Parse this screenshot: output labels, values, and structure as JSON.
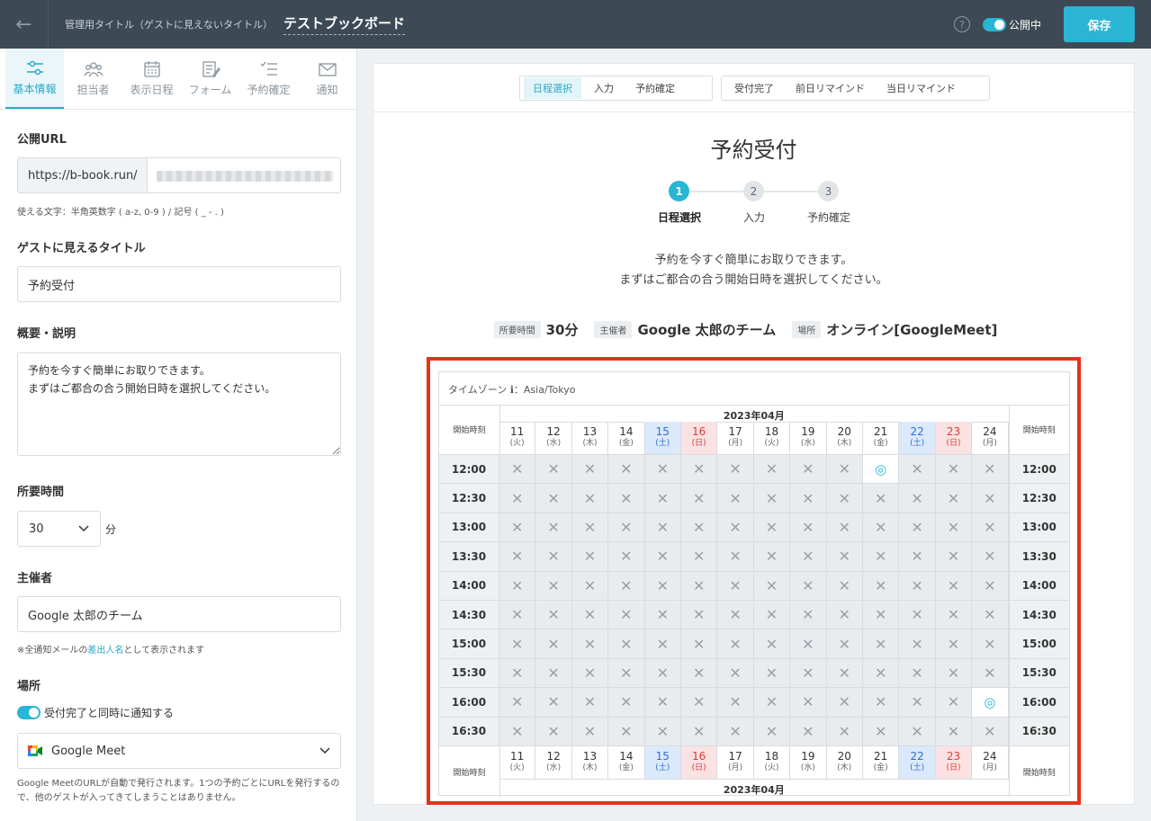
{
  "header": {
    "admin_title_label": "管理用タイトル（ゲストに見えないタイトル）",
    "board_title": "テストブックボード",
    "publish_label": "公開中",
    "save_label": "保存"
  },
  "sidebar_tabs": [
    {
      "label": "基本情報",
      "icon": "sliders-icon"
    },
    {
      "label": "担当者",
      "icon": "people-icon"
    },
    {
      "label": "表示日程",
      "icon": "calendar-icon"
    },
    {
      "label": "フォーム",
      "icon": "form-icon"
    },
    {
      "label": "予約確定",
      "icon": "list-check-icon"
    },
    {
      "label": "通知",
      "icon": "mail-icon"
    }
  ],
  "form": {
    "url_label": "公開URL",
    "url_prefix": "https://b-book.run/",
    "url_hint": "使える文字：半角英数字 ( a-z, 0-9 ) / 記号 ( _ - . )",
    "guest_title_label": "ゲストに見えるタイトル",
    "guest_title_value": "予約受付",
    "desc_label": "概要・説明",
    "desc_value": "予約を今すぐ簡単にお取りできます。\nまずはご都合の合う開始日時を選択してください。",
    "duration_label": "所要時間",
    "duration_value": "30",
    "duration_unit": "分",
    "organizer_label": "主催者",
    "organizer_value": "Google 太郎のチーム",
    "organizer_hint_pre": "※全通知メールの",
    "organizer_hint_link": "差出人名",
    "organizer_hint_post": "として表示されます",
    "place_label": "場所",
    "notify_label": "受付完了と同時に通知する",
    "place_value": "Google Meet",
    "meet_hint": "Google MeetのURLが自動で発行されます。1つの予約ごとにURLを発行するので、他のゲストが入ってきてしまうことはありません。"
  },
  "preview": {
    "tabs_group1": [
      "日程選択",
      "入力",
      "予約確定"
    ],
    "tabs_group2": [
      "受付完了",
      "前日リマインド",
      "当日リマインド"
    ],
    "title": "予約受付",
    "steps": [
      {
        "num": "1",
        "label": "日程選択"
      },
      {
        "num": "2",
        "label": "入力"
      },
      {
        "num": "3",
        "label": "予約確定"
      }
    ],
    "intro_line1": "予約を今すぐ簡単にお取りできます。",
    "intro_line2": "まずはご都合の合う開始日時を選択してください。",
    "meta": [
      {
        "tag": "所要時間",
        "value": "30分"
      },
      {
        "tag": "主催者",
        "value": "Google 太郎のチーム"
      },
      {
        "tag": "場所",
        "value": "オンライン[GoogleMeet]"
      }
    ]
  },
  "calendar": {
    "timezone_label": "タイムゾーン ℹ：Asia/Tokyo",
    "month": "2023年04月",
    "start_label": "開始時刻",
    "days": [
      {
        "d": "11",
        "w": "(火)",
        "type": "weekday"
      },
      {
        "d": "12",
        "w": "(水)",
        "type": "weekday"
      },
      {
        "d": "13",
        "w": "(木)",
        "type": "weekday"
      },
      {
        "d": "14",
        "w": "(金)",
        "type": "weekday"
      },
      {
        "d": "15",
        "w": "(土)",
        "type": "sat"
      },
      {
        "d": "16",
        "w": "(日)",
        "type": "sun"
      },
      {
        "d": "17",
        "w": "(月)",
        "type": "weekday"
      },
      {
        "d": "18",
        "w": "(火)",
        "type": "weekday"
      },
      {
        "d": "19",
        "w": "(水)",
        "type": "weekday"
      },
      {
        "d": "20",
        "w": "(木)",
        "type": "weekday"
      },
      {
        "d": "21",
        "w": "(金)",
        "type": "weekday"
      },
      {
        "d": "22",
        "w": "(土)",
        "type": "sat"
      },
      {
        "d": "23",
        "w": "(日)",
        "type": "sun"
      },
      {
        "d": "24",
        "w": "(月)",
        "type": "weekday"
      }
    ],
    "times": [
      "12:00",
      "12:30",
      "13:00",
      "13:30",
      "14:00",
      "14:30",
      "15:00",
      "15:30",
      "16:00",
      "16:30"
    ],
    "available": [
      {
        "time": "12:00",
        "day": "21"
      },
      {
        "time": "16:00",
        "day": "24"
      }
    ],
    "available_symbol": "◎",
    "unavailable_symbol": "✕"
  }
}
